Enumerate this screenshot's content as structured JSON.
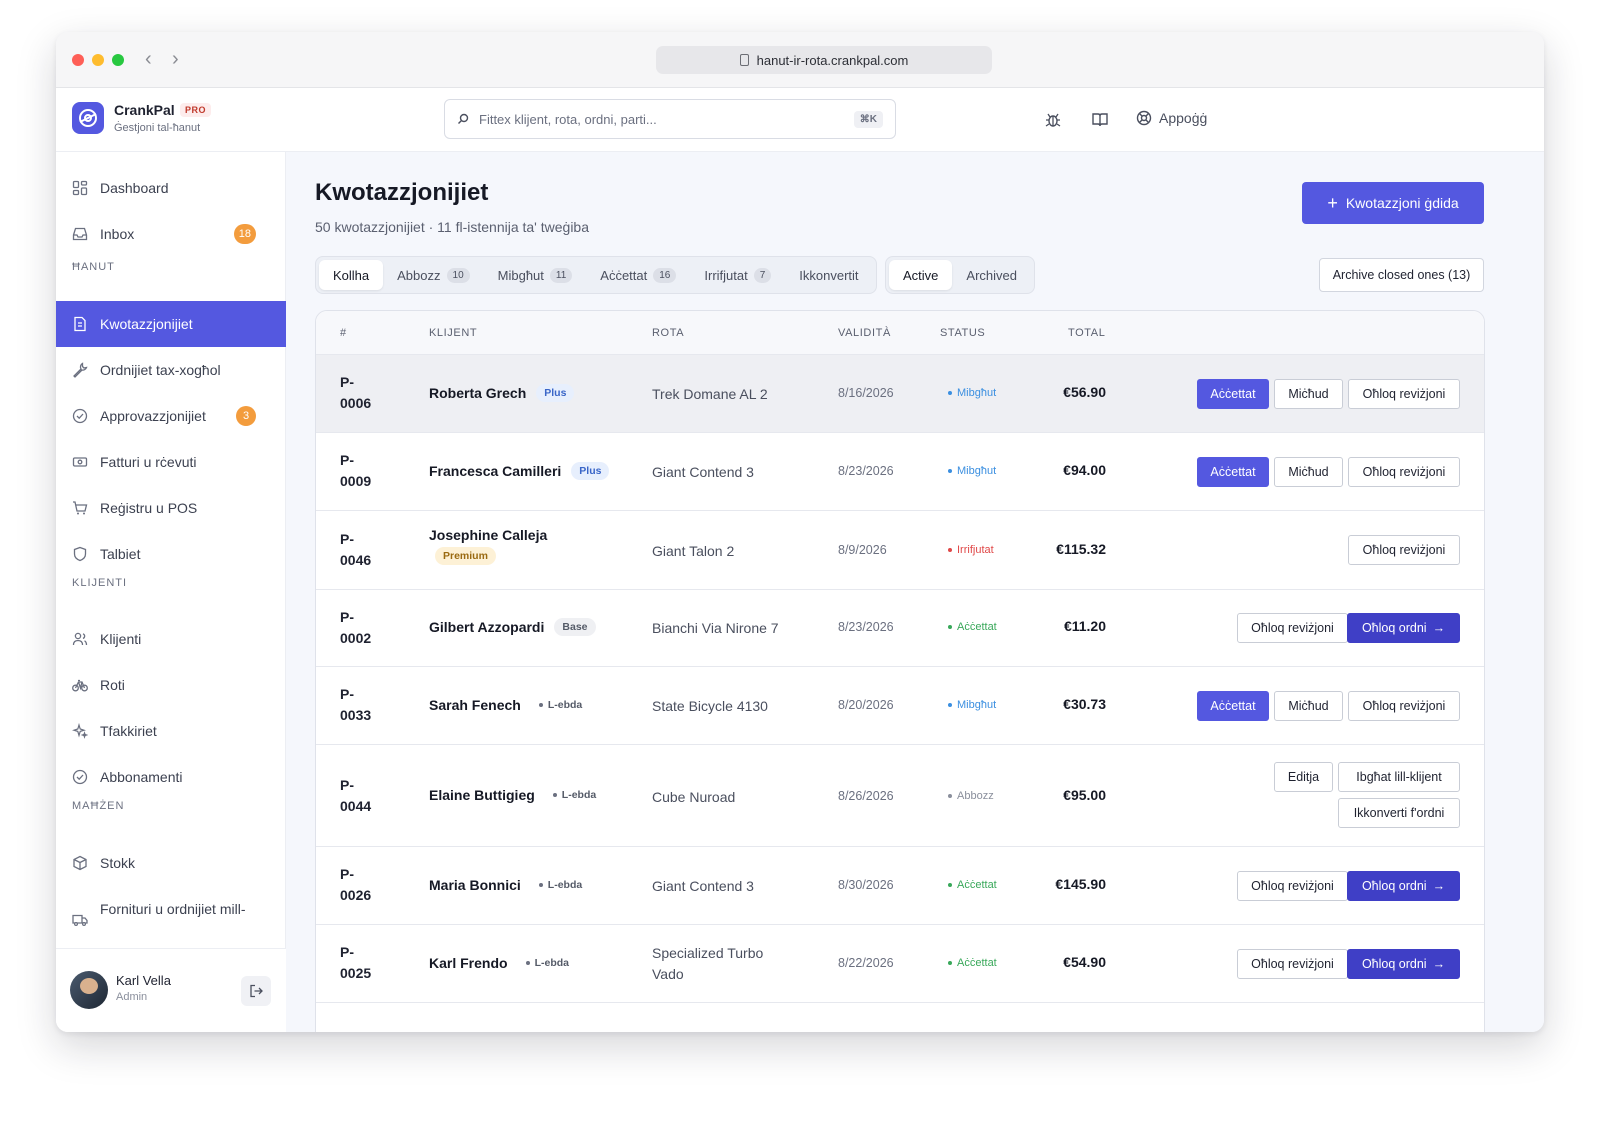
{
  "browser": {
    "url": "hanut-ir-rota.crankpal.com"
  },
  "brand": {
    "name": "CrankPal",
    "badge": "PRO",
    "subtitle": "Ġestjoni tal-ħanut"
  },
  "search": {
    "placeholder": "Fittex klijent, rota, ordni, parti...",
    "shortcut": "⌘K"
  },
  "topbar": {
    "help_label": "Appoġġ"
  },
  "sidebar": {
    "top_items": [
      {
        "label": "Dashboard"
      },
      {
        "label": "Inbox",
        "badge": "18"
      }
    ],
    "sections": [
      {
        "title": "ĦANUT",
        "items": [
          {
            "label": "Kwotazzjonijiet"
          },
          {
            "label": "Ordnijiet tax-xogħol"
          },
          {
            "label": "Approvazzjonijiet",
            "badge": "3"
          },
          {
            "label": "Fatturi u rċevuti"
          },
          {
            "label": "Reġistru u POS"
          },
          {
            "label": "Talbiet"
          }
        ]
      },
      {
        "title": "KLIJENTI",
        "items": [
          {
            "label": "Klijenti"
          },
          {
            "label": "Roti"
          },
          {
            "label": "Tfakkiriet"
          },
          {
            "label": "Abbonamenti"
          }
        ]
      },
      {
        "title": "MAĦŻEN",
        "items": [
          {
            "label": "Stokk"
          },
          {
            "label": "Fornituri u ordnijiet mill-"
          }
        ]
      }
    ],
    "user": {
      "name": "Karl Vella",
      "role": "Admin"
    }
  },
  "page": {
    "title": "Kwotazzjonijiet",
    "subtitle": "50 kwotazzjonijiet · 11 fl-istennija ta' tweġiba",
    "new_button": "Kwotazzjoni ġdida",
    "status_tabs": [
      {
        "label": "Kollha"
      },
      {
        "label": "Abbozz",
        "count": "10"
      },
      {
        "label": "Mibgħut",
        "count": "11"
      },
      {
        "label": "Aċċettat",
        "count": "16"
      },
      {
        "label": "Irrifjutat",
        "count": "7"
      },
      {
        "label": "Ikkonvertit"
      }
    ],
    "view_tabs": [
      {
        "label": "Active"
      },
      {
        "label": "Archived"
      }
    ],
    "archive_button": "Archive closed ones (13)"
  },
  "table": {
    "headers": {
      "id": "#",
      "customer": "KLIJENT",
      "bike": "ROTA",
      "validity": "VALIDITÀ",
      "status": "STATUS",
      "total": "TOTAL"
    },
    "rows": [
      {
        "id_prefix": "P-",
        "id_num": "0006",
        "customer": "Roberta Grech",
        "tier": "Plus",
        "bike": "Trek Domane AL 2",
        "validity": "8/16/2026",
        "status": "Mibgħut",
        "total": "€56.90",
        "actions": [
          "Aċċettat",
          "Miċħud",
          "Oħloq reviżjoni"
        ]
      },
      {
        "id_prefix": "P-",
        "id_num": "0009",
        "customer": "Francesca Camilleri",
        "tier": "Plus",
        "bike": "Giant Contend 3",
        "validity": "8/23/2026",
        "status": "Mibgħut",
        "total": "€94.00",
        "actions": [
          "Aċċettat",
          "Miċħud",
          "Oħloq reviżjoni"
        ]
      },
      {
        "id_prefix": "P-",
        "id_num": "0046",
        "customer": "Josephine Calleja",
        "tier": "Premium",
        "bike": "Giant Talon 2",
        "validity": "8/9/2026",
        "status": "Irrifjutat",
        "total": "€115.32",
        "actions": [
          "Oħloq reviżjoni"
        ]
      },
      {
        "id_prefix": "P-",
        "id_num": "0002",
        "customer": "Gilbert Azzopardi",
        "tier": "Base",
        "bike": "Bianchi Via Nirone 7",
        "validity": "8/23/2026",
        "status": "Aċċettat",
        "total": "€11.20",
        "actions": [
          "Oħloq reviżjoni",
          "Oħloq ordni"
        ]
      },
      {
        "id_prefix": "P-",
        "id_num": "0033",
        "customer": "Sarah Fenech",
        "tier": "L-ebda",
        "bike": "State Bicycle 4130",
        "validity": "8/20/2026",
        "status": "Mibgħut",
        "total": "€30.73",
        "actions": [
          "Aċċettat",
          "Miċħud",
          "Oħloq reviżjoni"
        ]
      },
      {
        "id_prefix": "P-",
        "id_num": "0044",
        "customer": "Elaine Buttigieg",
        "tier": "L-ebda",
        "bike": "Cube Nuroad",
        "validity": "8/26/2026",
        "status": "Abbozz",
        "total": "€95.00",
        "actions": [
          "Editja",
          "Ibgħat lill-klijent",
          "Ikkonverti f'ordni"
        ]
      },
      {
        "id_prefix": "P-",
        "id_num": "0026",
        "customer": "Maria Bonnici",
        "tier": "L-ebda",
        "bike": "Giant Contend 3",
        "validity": "8/30/2026",
        "status": "Aċċettat",
        "total": "€145.90",
        "actions": [
          "Oħloq reviżjoni",
          "Oħloq ordni"
        ]
      },
      {
        "id_prefix": "P-",
        "id_num": "0025",
        "customer": "Karl Frendo",
        "tier": "L-ebda",
        "bike_line1": "Specialized Turbo",
        "bike_line2": "Vado",
        "validity": "8/22/2026",
        "status": "Aċċettat",
        "total": "€54.90",
        "actions": [
          "Oħloq reviżjoni",
          "Oħloq ordni"
        ]
      }
    ]
  },
  "colors": {
    "accent": "#5458e0",
    "sent": "#3b8fe0",
    "rejected": "#e04848",
    "accepted": "#39a85a",
    "draft": "#8a8f9c",
    "badge": "#f39c3d"
  }
}
